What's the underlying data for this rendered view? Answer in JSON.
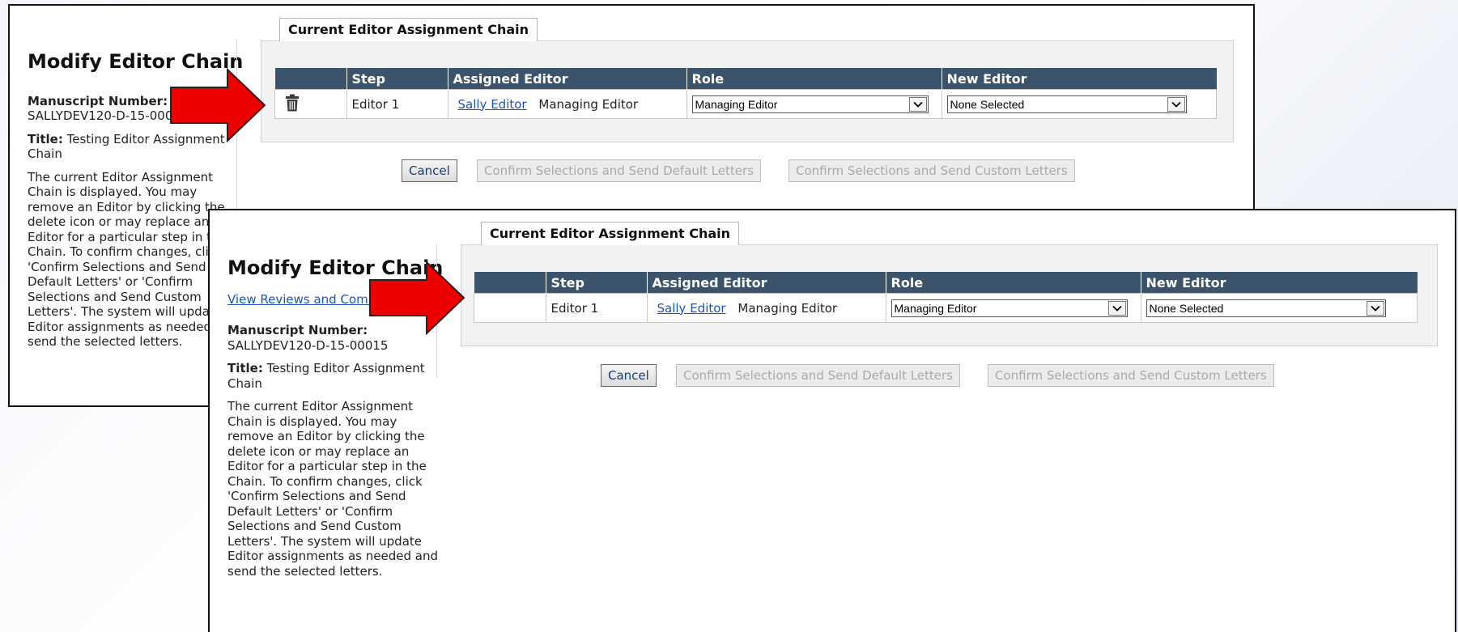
{
  "screens": [
    {
      "id": "before",
      "sidebar": {
        "title": "Modify Editor Chain",
        "manuscript_label": "Manuscript Number:",
        "manuscript_value": "SALLYDEV120-D-15-00015",
        "title_label": "Title:",
        "title_value": "Testing Editor Assignment Chain",
        "help": "The current Editor Assignment Chain is displayed. You may remove an Editor by clicking the delete icon or may replace an Editor for a particular step in the Chain. To confirm changes, click 'Confirm Selections and Send Default Letters' or 'Confirm Selections and Send Custom Letters'. The system will update Editor assignments as needed and send the selected letters."
      },
      "tab_label": "Current Editor Assignment Chain",
      "columns": [
        "",
        "Step",
        "Assigned Editor",
        "Role",
        "New Editor"
      ],
      "row": {
        "step": "Editor 1",
        "editor_name": "Sally Editor",
        "editor_role": "Managing Editor",
        "role_select": "Managing Editor",
        "new_editor_select": "None Selected",
        "delete_icon": "trash-icon"
      },
      "buttons": {
        "cancel": "Cancel",
        "confirm_default": "Confirm Selections and Send Default Letters",
        "confirm_custom": "Confirm Selections and Send Custom Letters"
      }
    },
    {
      "id": "after",
      "sidebar": {
        "title": "Modify Editor Chain",
        "link": "View Reviews and Comments",
        "manuscript_label": "Manuscript Number:",
        "manuscript_value": "SALLYDEV120-D-15-00015",
        "title_label": "Title:",
        "title_value": "Testing Editor Assignment Chain",
        "help": "The current Editor Assignment Chain is displayed. You may remove an Editor by clicking the delete icon or may replace an Editor for a particular step in the Chain. To confirm changes, click 'Confirm Selections and Send Default Letters' or 'Confirm Selections and Send Custom Letters'. The system will update Editor assignments as needed and send the selected letters."
      },
      "tab_label": "Current Editor Assignment Chain",
      "columns": [
        "",
        "Step",
        "Assigned Editor",
        "Role",
        "New Editor"
      ],
      "row": {
        "step": "Editor 1",
        "editor_name": "Sally Editor",
        "editor_role": "Managing Editor",
        "role_select": "Managing Editor",
        "new_editor_select": "None Selected"
      },
      "buttons": {
        "cancel": "Cancel",
        "confirm_default": "Confirm Selections and Send Default Letters",
        "confirm_custom": "Confirm Selections and Send Custom Letters"
      }
    }
  ],
  "colors": {
    "header_bg": "#3b546b",
    "link": "#1a55b8",
    "arrow": "#ee0000"
  }
}
